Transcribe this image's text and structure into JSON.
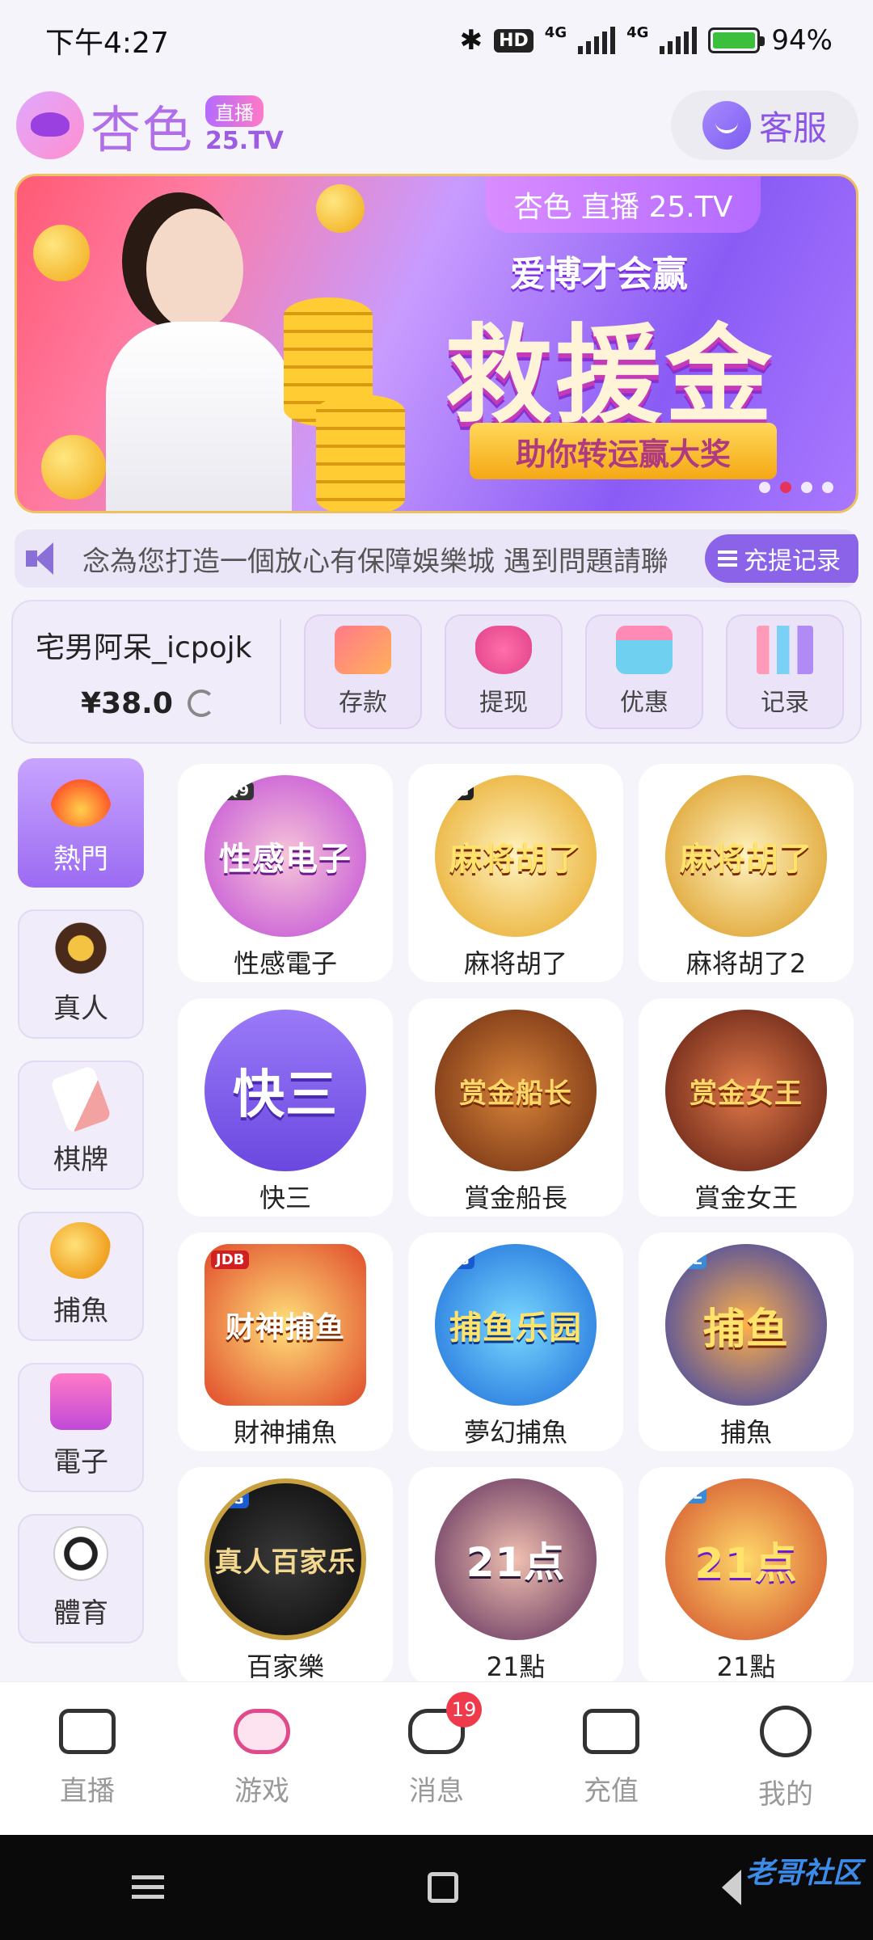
{
  "status_bar": {
    "time": "下午4:27",
    "hd": "HD",
    "net1": "4G",
    "net2": "4G",
    "battery": "94%"
  },
  "header": {
    "logo_text": "杏色",
    "logo_pill": "直播",
    "logo_domain": "25.TV",
    "service_label": "客服"
  },
  "banner": {
    "brand": "杏色 直播 25.TV",
    "tag": "爱博才会赢",
    "title": "救援金",
    "ribbon": "助你转运赢大奖",
    "active_dot": 1
  },
  "marquee": {
    "text": "念為您打造一個放心有保障娛樂城  遇到問題請聯",
    "records_label": "充提记录"
  },
  "wallet": {
    "username": "宅男阿呆_icpojk",
    "balance": "¥38.0",
    "actions": [
      {
        "label": "存款",
        "icon": "card-icon"
      },
      {
        "label": "提现",
        "icon": "money-bag-icon"
      },
      {
        "label": "优惠",
        "icon": "gift-icon"
      },
      {
        "label": "记录",
        "icon": "bar-chart-icon"
      }
    ]
  },
  "categories": [
    {
      "label": "熱門",
      "icon": "fire-icon",
      "active": true
    },
    {
      "label": "真人",
      "icon": "chip-icon"
    },
    {
      "label": "棋牌",
      "icon": "card-icon"
    },
    {
      "label": "捕魚",
      "icon": "fish-icon"
    },
    {
      "label": "電子",
      "icon": "slot-icon"
    },
    {
      "label": "體育",
      "icon": "soccer-ball-icon"
    }
  ],
  "games": [
    {
      "label": "性感電子",
      "art": "性感电子",
      "provider": "CQ9"
    },
    {
      "label": "麻将胡了",
      "art": "麻将胡了",
      "provider": "PG"
    },
    {
      "label": "麻将胡了2",
      "art": "麻将胡了",
      "provider": ""
    },
    {
      "label": "快三",
      "art": "快三",
      "provider": ""
    },
    {
      "label": "賞金船長",
      "art": "赏金船长",
      "provider": ""
    },
    {
      "label": "賞金女王",
      "art": "赏金女王",
      "provider": ""
    },
    {
      "label": "財神捕魚",
      "art": "财神捕鱼",
      "provider": "JDB"
    },
    {
      "label": "夢幻捕魚",
      "art": "捕鱼乐园",
      "provider": "AG"
    },
    {
      "label": "捕魚",
      "art": "捕鱼",
      "provider": "WL"
    },
    {
      "label": "百家樂",
      "art": "真人百家乐",
      "provider": "AG"
    },
    {
      "label": "21點",
      "art": "21点",
      "provider": ""
    },
    {
      "label": "21點",
      "art": "21点",
      "provider": "WL"
    }
  ],
  "bottom_nav": [
    {
      "label": "直播",
      "icon": "camera-icon"
    },
    {
      "label": "游戏",
      "icon": "gamepad-icon"
    },
    {
      "label": "消息",
      "icon": "chat-icon",
      "badge": "19"
    },
    {
      "label": "充值",
      "icon": "wallet-icon"
    },
    {
      "label": "我的",
      "icon": "profile-icon"
    }
  ],
  "watermark": "老哥社区",
  "colors": {
    "accent": "#8a63e8",
    "badge": "#ee3a4a"
  }
}
